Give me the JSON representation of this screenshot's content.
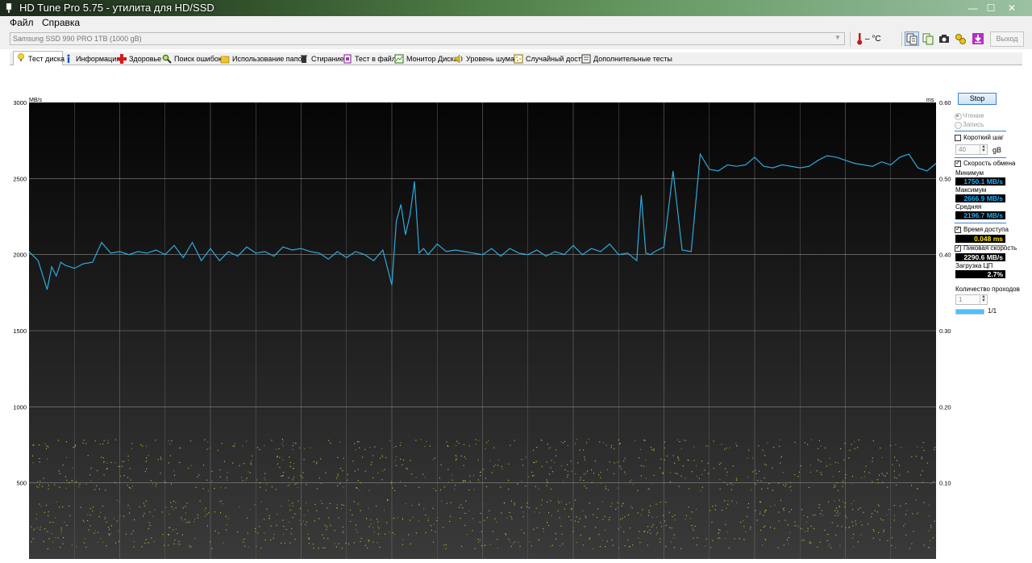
{
  "window": {
    "title": "HD Tune Pro 5.75 - утилита для HD/SSD",
    "minimize": "—",
    "maximize": "☐",
    "close": "✕"
  },
  "menu": [
    "Файл",
    "Справка"
  ],
  "toolbar": {
    "drive": "Samsung SSD 990 PRO 1TB (1000 gB)",
    "temperature": "– °C",
    "exit_label": "Выход"
  },
  "tabs": [
    {
      "label": "Тест диска",
      "icon": "benchmark-icon",
      "active": true
    },
    {
      "label": "Информация",
      "icon": "info-icon",
      "active": false
    },
    {
      "label": "Здоровье",
      "icon": "health-cross-icon",
      "active": false
    },
    {
      "label": "Поиск ошибок",
      "icon": "magnifier-icon",
      "active": false
    },
    {
      "label": "Использование папок",
      "icon": "folder-icon",
      "active": false
    },
    {
      "label": "Стирание",
      "icon": "trash-icon",
      "active": false
    },
    {
      "label": "Тест в файл",
      "icon": "file-test-icon",
      "active": false
    },
    {
      "label": "Монитор Диска",
      "icon": "monitor-icon",
      "active": false
    },
    {
      "label": "Уровень шума",
      "icon": "speaker-icon",
      "active": false
    },
    {
      "label": "Случайный доступ",
      "icon": "random-access-icon",
      "active": false
    },
    {
      "label": "Дополнительные  тесты",
      "icon": "extra-tests-icon",
      "active": false
    }
  ],
  "panel": {
    "stop_label": "Stop",
    "read_label": "Чтение",
    "write_label": "Запись",
    "short_step_label": "Короткий шаг",
    "short_step_value": "40",
    "short_step_unit": "gB",
    "transfer_rate_label": "Скорость обмена",
    "min_label": "Минимум",
    "min_value": "1750.1 MB/s",
    "max_label": "Максимум",
    "max_value": "2666.9 MB/s",
    "avg_label": "Средняя",
    "avg_value": "2196.7 MB/s",
    "access_time_label": "Время доступа",
    "access_time_value": "0.048 ms",
    "burst_label": "Пиковая скорость",
    "burst_value": "2290.6 MB/s",
    "cpu_label": "Загрузка ЦП",
    "cpu_value": "2.7%",
    "passes_label": "Количество проходов",
    "passes_value": "1",
    "progress_text": "1/1",
    "progress_fraction": 1.0
  },
  "chart_data": {
    "type": "line",
    "ylabel": "MB/s",
    "y2label": "ms",
    "ylim": [
      0,
      3000
    ],
    "y2lim": [
      0,
      0.6
    ],
    "yticks": [
      500,
      1000,
      1500,
      2000,
      2500,
      3000
    ],
    "y2ticks": [
      "0.10",
      "0.20",
      "0.30",
      "0.40",
      "0.50",
      "0.60"
    ],
    "xlim": [
      0,
      1000
    ],
    "xticks": [
      0,
      100,
      200,
      300,
      400,
      500,
      600,
      700,
      800,
      900,
      1000
    ],
    "grid": true,
    "series": [
      {
        "color": "#2ea8dc",
        "x": [
          0,
          10,
          20,
          25,
          30,
          35,
          40,
          50,
          60,
          70,
          80,
          90,
          100,
          110,
          120,
          130,
          140,
          150,
          160,
          170,
          180,
          190,
          200,
          210,
          220,
          230,
          240,
          250,
          260,
          270,
          280,
          290,
          300,
          310,
          320,
          330,
          340,
          350,
          360,
          370,
          380,
          390,
          400,
          405,
          410,
          415,
          420,
          425,
          430,
          435,
          440,
          450,
          460,
          470,
          480,
          490,
          500,
          510,
          520,
          530,
          540,
          550,
          560,
          570,
          580,
          590,
          600,
          610,
          620,
          630,
          640,
          650,
          660,
          670,
          675,
          680,
          685,
          690,
          700,
          710,
          720,
          730,
          740,
          750,
          760,
          770,
          780,
          790,
          800,
          810,
          820,
          830,
          840,
          850,
          860,
          870,
          880,
          890,
          900,
          910,
          920,
          930,
          940,
          950,
          960,
          970,
          980,
          990,
          1000
        ],
        "values": [
          2020,
          1960,
          1770,
          1920,
          1860,
          1950,
          1930,
          1910,
          1940,
          1950,
          2080,
          2010,
          2020,
          2000,
          2020,
          2010,
          2030,
          2000,
          2060,
          1980,
          2080,
          1960,
          2040,
          1960,
          2020,
          1990,
          2050,
          2010,
          2020,
          1990,
          2050,
          2030,
          2040,
          2020,
          2010,
          1970,
          2020,
          1980,
          2020,
          2000,
          1960,
          2030,
          1800,
          2220,
          2330,
          2130,
          2260,
          2480,
          2010,
          2040,
          2000,
          2070,
          2020,
          2030,
          2020,
          2010,
          2000,
          2040,
          1990,
          2040,
          2010,
          2000,
          2030,
          1990,
          2020,
          2000,
          2060,
          2000,
          2040,
          2020,
          2070,
          2000,
          2010,
          1960,
          2390,
          2010,
          2000,
          2020,
          2050,
          2550,
          2030,
          2020,
          2660,
          2560,
          2550,
          2590,
          2580,
          2590,
          2640,
          2580,
          2570,
          2590,
          2580,
          2570,
          2580,
          2620,
          2650,
          2640,
          2620,
          2600,
          2590,
          2580,
          2610,
          2590,
          2640,
          2660,
          2570,
          2550,
          2600
        ]
      }
    ]
  }
}
